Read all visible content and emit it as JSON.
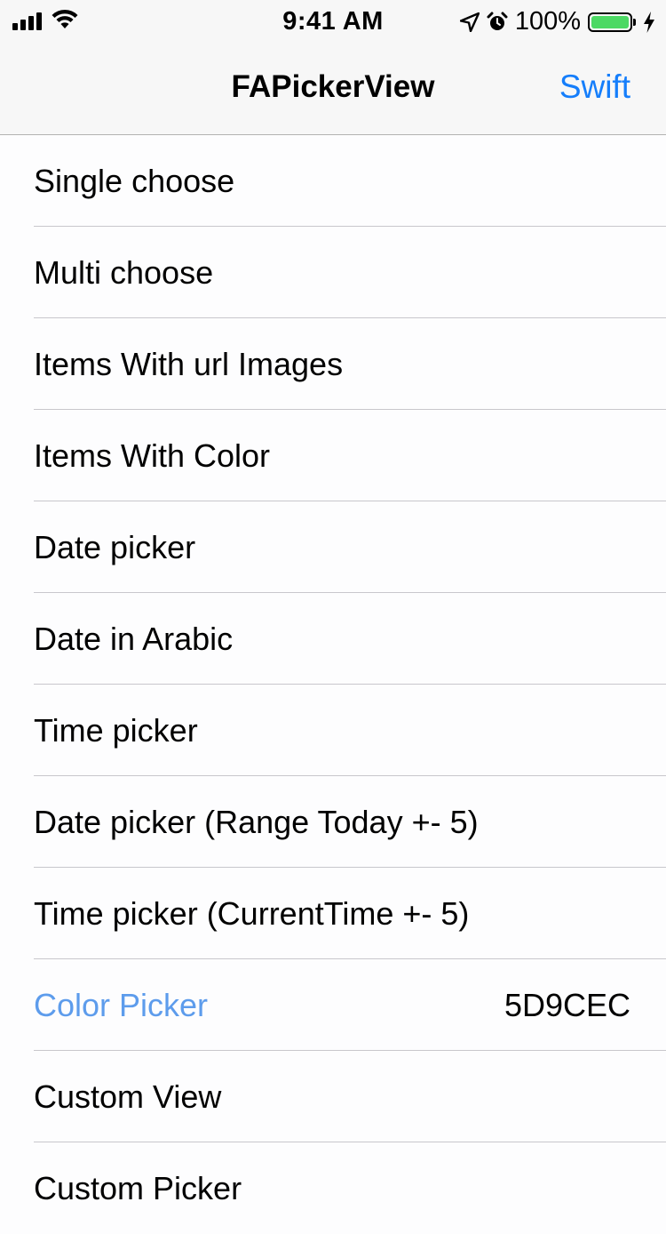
{
  "status_bar": {
    "time": "9:41 AM",
    "battery": "100%",
    "battery_level": 1.0,
    "icons": [
      "signal-icon",
      "wifi-icon",
      "location-arrow-icon",
      "alarm-icon",
      "battery-icon",
      "charging-bolt-icon"
    ]
  },
  "nav": {
    "title": "FAPickerView",
    "right_button": "Swift"
  },
  "colors": {
    "accent": "#157efb",
    "selected_item": "#5d9cec",
    "battery_fill": "#4cd964"
  },
  "list": {
    "items": [
      {
        "label": "Single choose"
      },
      {
        "label": "Multi choose"
      },
      {
        "label": "Items With url Images"
      },
      {
        "label": "Items With Color"
      },
      {
        "label": "Date picker"
      },
      {
        "label": "Date in Arabic"
      },
      {
        "label": "Time picker"
      },
      {
        "label": "Date picker (Range Today +- 5)"
      },
      {
        "label": "Time picker (CurrentTime +- 5)"
      },
      {
        "label": "Color Picker",
        "detail": "5D9CEC"
      },
      {
        "label": "Custom View"
      },
      {
        "label": "Custom Picker"
      }
    ]
  }
}
